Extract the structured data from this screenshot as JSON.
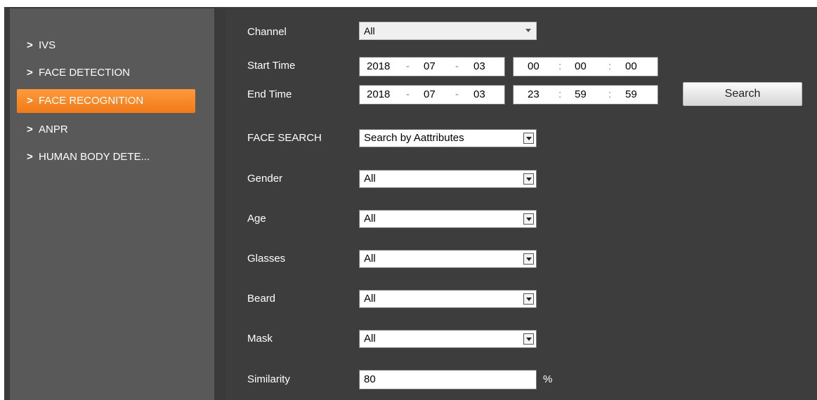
{
  "sidebar": {
    "items": [
      {
        "label": "IVS",
        "active": false
      },
      {
        "label": "FACE DETECTION",
        "active": false
      },
      {
        "label": "FACE RECOGNITION",
        "active": true
      },
      {
        "label": "ANPR",
        "active": false
      },
      {
        "label": "HUMAN BODY DETE..."
      }
    ]
  },
  "form": {
    "channel_label": "Channel",
    "channel_value": "All",
    "start_time_label": "Start Time",
    "start": {
      "year": "2018",
      "month": "07",
      "day": "03",
      "hour": "00",
      "minute": "00",
      "second": "00"
    },
    "end_time_label": "End Time",
    "end": {
      "year": "2018",
      "month": "07",
      "day": "03",
      "hour": "23",
      "minute": "59",
      "second": "59"
    },
    "date_sep": "-",
    "time_sep": ":",
    "search_button": "Search",
    "face_search_label": "FACE SEARCH",
    "face_search_value": "Search by Aattributes",
    "gender_label": "Gender",
    "gender_value": "All",
    "age_label": "Age",
    "age_value": "All",
    "glasses_label": "Glasses",
    "glasses_value": "All",
    "beard_label": "Beard",
    "beard_value": "All",
    "mask_label": "Mask",
    "mask_value": "All",
    "similarity_label": "Similarity",
    "similarity_value": "80",
    "similarity_unit": "%"
  },
  "colors": {
    "accent": "#f07a18",
    "sidebar_bg": "#595959",
    "main_bg": "#3d3d3d"
  }
}
